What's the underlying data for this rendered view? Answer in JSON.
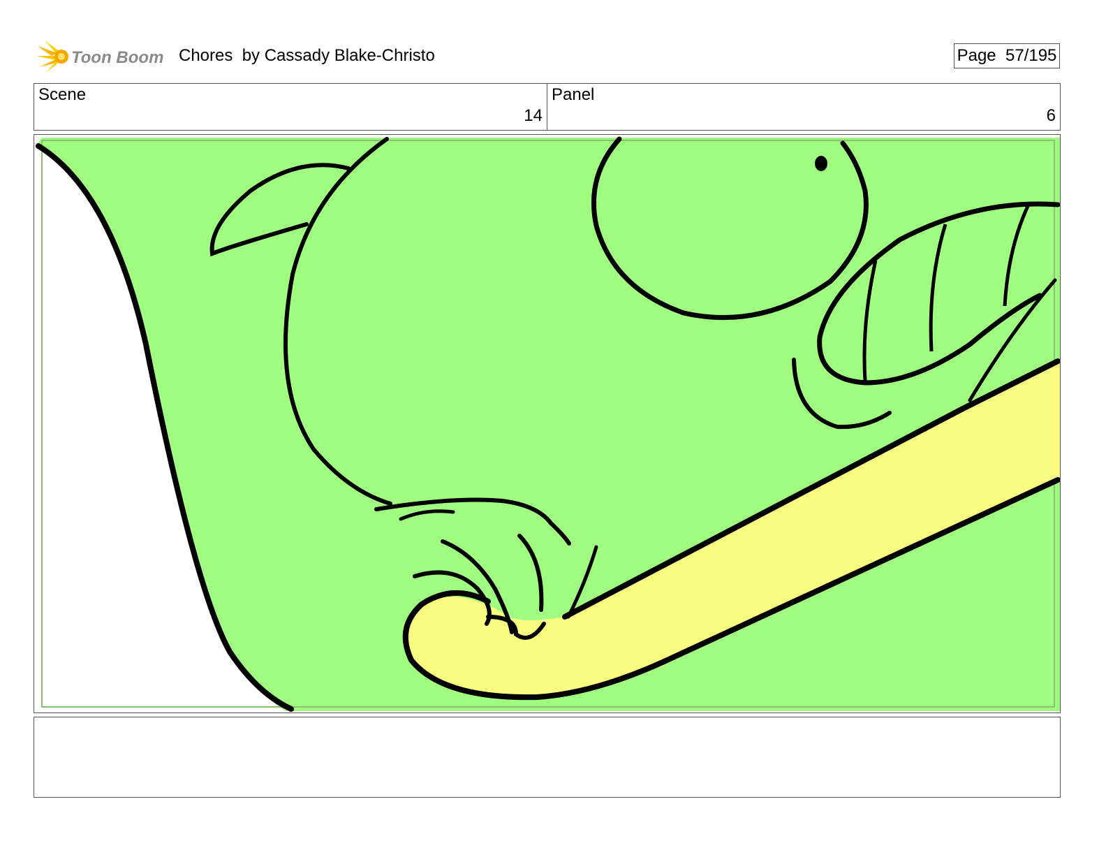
{
  "header": {
    "logo_text": "Toon Boom",
    "title": "Chores  by Cassady Blake-Christo",
    "page_label": "Page  57/195"
  },
  "info": {
    "scene_label": "Scene",
    "scene_value": "14",
    "panel_label": "Panel",
    "panel_value": "6"
  },
  "panel_art": {
    "description_icon": "storyboard-drawing",
    "colors": {
      "body_green": "#a0fe80",
      "tube_yellow": "#fafe80",
      "outline": "#000000"
    }
  },
  "notes": {
    "text": ""
  }
}
